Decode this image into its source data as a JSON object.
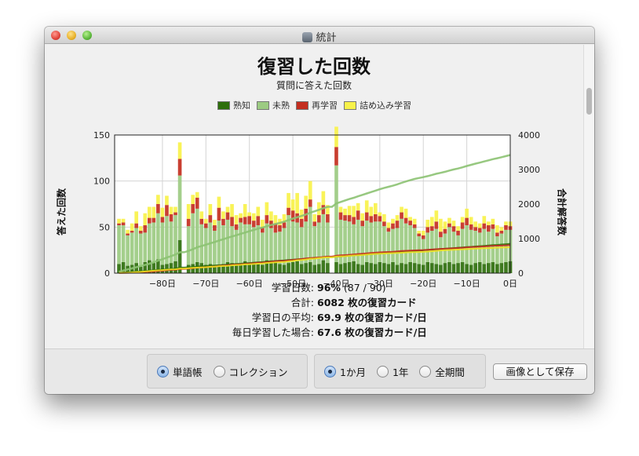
{
  "window": {
    "title": "統計"
  },
  "chart_data": {
    "type": "bar",
    "title": "復習した回数",
    "subtitle": "質問に答えた回数",
    "ylabel": "答えた回数",
    "y2label": "合計解答数",
    "ylim": [
      0,
      150
    ],
    "y2lim": [
      0,
      4000
    ],
    "xlim": [
      -91,
      0
    ],
    "y_ticks": [
      "0",
      "50",
      "100",
      "150"
    ],
    "y2_ticks": [
      "0",
      "1000",
      "2000",
      "3000",
      "4000"
    ],
    "x_ticks": [
      "−80日",
      "−70日",
      "−60日",
      "−50日",
      "−40日",
      "−30日",
      "−20日",
      "−10日",
      "0日"
    ],
    "grid": true,
    "legend_position": "top",
    "legend": [
      {
        "name": "熟知",
        "color": "#2e6f0c"
      },
      {
        "name": "未熟",
        "color": "#9ccb82"
      },
      {
        "name": "再学習",
        "color": "#c42f20"
      },
      {
        "name": "詰め込み学習",
        "color": "#f8f24a"
      }
    ],
    "x": [
      -90,
      -89,
      -88,
      -87,
      -86,
      -85,
      -84,
      -83,
      -82,
      -81,
      -80,
      -79,
      -78,
      -77,
      -76,
      -75,
      -74,
      -73,
      -72,
      -71,
      -70,
      -69,
      -68,
      -67,
      -66,
      -65,
      -64,
      -63,
      -62,
      -61,
      -60,
      -59,
      -58,
      -57,
      -56,
      -55,
      -54,
      -53,
      -52,
      -51,
      -50,
      -49,
      -48,
      -47,
      -46,
      -45,
      -44,
      -43,
      -42,
      -41,
      -40,
      -39,
      -38,
      -37,
      -36,
      -35,
      -34,
      -33,
      -32,
      -31,
      -30,
      -29,
      -28,
      -27,
      -26,
      -25,
      -24,
      -23,
      -22,
      -21,
      -20,
      -19,
      -18,
      -17,
      -16,
      -15,
      -14,
      -13,
      -12,
      -11,
      -10,
      -9,
      -8,
      -7,
      -6,
      -5,
      -4,
      -3,
      -2,
      -1,
      0
    ],
    "series": [
      {
        "name": "熟知",
        "values": [
          10,
          12,
          8,
          9,
          11,
          7,
          12,
          14,
          11,
          15,
          9,
          10,
          11,
          13,
          36,
          0,
          9,
          10,
          12,
          11,
          9,
          10,
          8,
          9,
          10,
          12,
          11,
          9,
          10,
          13,
          11,
          12,
          10,
          9,
          14,
          11,
          12,
          10,
          9,
          11,
          12,
          13,
          10,
          11,
          12,
          9,
          10,
          14,
          11,
          0,
          12,
          10,
          11,
          12,
          13,
          10,
          9,
          12,
          11,
          10,
          12,
          11,
          10,
          12,
          9,
          11,
          10,
          12,
          11,
          10,
          9,
          12,
          11,
          10,
          9,
          11,
          12,
          10,
          11,
          12,
          10,
          9,
          11,
          12,
          10,
          11,
          12,
          10,
          11,
          12,
          13
        ]
      },
      {
        "name": "未熟",
        "values": [
          42,
          40,
          33,
          35,
          38,
          36,
          32,
          40,
          44,
          50,
          46,
          52,
          45,
          50,
          70,
          0,
          42,
          55,
          58,
          42,
          40,
          45,
          38,
          48,
          42,
          46,
          40,
          38,
          45,
          40,
          42,
          38,
          42,
          35,
          40,
          38,
          32,
          35,
          40,
          52,
          44,
          42,
          40,
          45,
          60,
          42,
          45,
          50,
          44,
          0,
          105,
          48,
          46,
          44,
          40,
          48,
          42,
          45,
          44,
          46,
          44,
          40,
          35,
          36,
          40,
          48,
          44,
          40,
          38,
          30,
          28,
          32,
          35,
          38,
          30,
          32,
          38,
          35,
          30,
          36,
          42,
          38,
          35,
          32,
          38,
          34,
          36,
          30,
          32,
          35,
          34
        ]
      },
      {
        "name": "再学習",
        "values": [
          2,
          3,
          2,
          2,
          5,
          3,
          8,
          6,
          5,
          10,
          6,
          12,
          8,
          3,
          18,
          0,
          8,
          10,
          12,
          6,
          5,
          8,
          6,
          14,
          7,
          8,
          10,
          6,
          5,
          8,
          9,
          7,
          10,
          6,
          9,
          8,
          10,
          7,
          6,
          8,
          12,
          10,
          9,
          14,
          8,
          5,
          8,
          10,
          9,
          0,
          20,
          8,
          6,
          7,
          8,
          10,
          6,
          9,
          7,
          8,
          6,
          5,
          4,
          6,
          8,
          7,
          6,
          5,
          4,
          3,
          4,
          6,
          5,
          8,
          6,
          5,
          4,
          6,
          5,
          7,
          8,
          6,
          4,
          5,
          6,
          7,
          5,
          4,
          3,
          5,
          4
        ]
      },
      {
        "name": "詰め込み学習",
        "values": [
          5,
          4,
          4,
          8,
          13,
          5,
          13,
          12,
          12,
          10,
          10,
          10,
          8,
          6,
          18,
          0,
          16,
          10,
          6,
          8,
          5,
          12,
          6,
          12,
          8,
          6,
          14,
          10,
          5,
          14,
          4,
          8,
          10,
          8,
          14,
          10,
          9,
          7,
          9,
          16,
          12,
          22,
          10,
          14,
          20,
          8,
          14,
          15,
          10,
          0,
          22,
          6,
          7,
          10,
          12,
          8,
          8,
          13,
          10,
          12,
          4,
          8,
          6,
          5,
          6,
          6,
          10,
          4,
          6,
          3,
          5,
          8,
          10,
          12,
          14,
          8,
          6,
          6,
          5,
          6,
          10,
          8,
          6,
          5,
          8,
          4,
          6,
          8,
          4,
          4,
          5
        ]
      }
    ],
    "cumulative_lines": [
      {
        "name": "熟知",
        "color": "#2e6f0c",
        "end": 850
      },
      {
        "name": "未熟",
        "color": "#8cc272",
        "end": 3420
      },
      {
        "name": "再学習",
        "color": "#c42f20",
        "end": 810
      },
      {
        "name": "詰め込み学習",
        "color": "#f0e020",
        "end": 750
      }
    ]
  },
  "stats": {
    "rows": [
      {
        "label": "学習日数:",
        "value_bold": "96%",
        "value_rest": " (87 / 90)"
      },
      {
        "label": "合計:",
        "value_bold": "6082 枚の復習カード",
        "value_rest": ""
      },
      {
        "label": "学習日の平均:",
        "value_bold": "69.9 枚の復習カード/日",
        "value_rest": ""
      },
      {
        "label": "毎日学習した場合:",
        "value_bold": "67.6 枚の復習カード/日",
        "value_rest": ""
      }
    ]
  },
  "controls": {
    "scope": [
      {
        "label": "単語帳",
        "selected": true
      },
      {
        "label": "コレクション",
        "selected": false
      }
    ],
    "period": [
      {
        "label": "1か月",
        "selected": true
      },
      {
        "label": "1年",
        "selected": false
      },
      {
        "label": "全期間",
        "selected": false
      }
    ],
    "save_label": "画像として保存"
  }
}
